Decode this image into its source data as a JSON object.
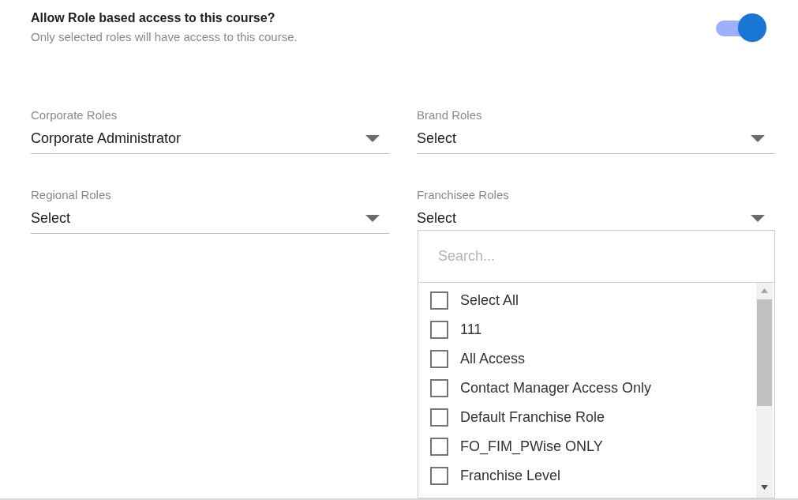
{
  "header": {
    "title": "Allow Role based access to this course?",
    "subtitle": "Only selected roles will have access to this course.",
    "toggle_on": true
  },
  "fields": [
    {
      "label": "Corporate Roles",
      "value": "Corporate Administrator",
      "expanded": false
    },
    {
      "label": "Brand Roles",
      "value": "Select",
      "expanded": false
    },
    {
      "label": "Regional Roles",
      "value": "Select",
      "expanded": false
    },
    {
      "label": "Franchisee Roles",
      "value": "Select",
      "expanded": true
    }
  ],
  "dropdown": {
    "search_placeholder": "Search...",
    "options": [
      {
        "label": "Select All",
        "checked": false
      },
      {
        "label": "111",
        "checked": false
      },
      {
        "label": "All Access",
        "checked": false
      },
      {
        "label": "Contact Manager Access Only",
        "checked": false
      },
      {
        "label": "Default Franchise Role",
        "checked": false
      },
      {
        "label": "FO_FIM_PWise ONLY",
        "checked": false
      },
      {
        "label": "Franchise Level",
        "checked": false
      }
    ]
  }
}
